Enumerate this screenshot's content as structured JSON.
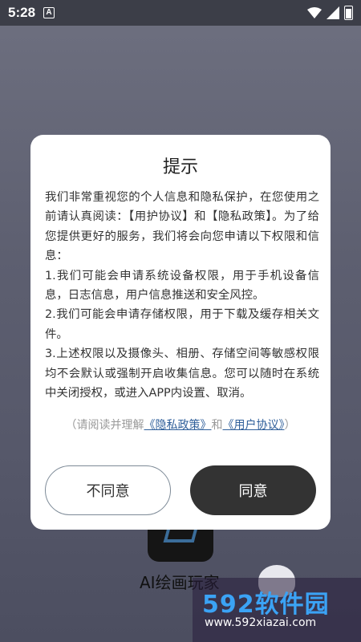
{
  "status_bar": {
    "time": "5:28",
    "notification_icon": "A"
  },
  "background_app": {
    "name": "AI绘画玩家"
  },
  "dialog": {
    "title": "提示",
    "paragraphs": [
      "我们非常重视您的个人信息和隐私保护，在您使用之前请认真阅读：【用护协议】和【隐私政策】。为了给您提供更好的服务，我们将会向您申请以下权限和信息：",
      "1.我们可能会申请系统设备权限，用于手机设备信息，日志信息，用户信息推送和安全风控。",
      "2.我们可能会申请存储权限，用于下载及缓存相关文件。",
      "3.上述权限以及摄像头、相册、存储空间等敏感权限均不会默认或强制开启收集信息。您可以随时在系统中关闭授权，或进入APP内设置、取消。"
    ],
    "hint_prefix": "（请阅读并理解",
    "privacy_link": "《隐私政策》",
    "hint_and": "和",
    "user_link": "《用户协议》",
    "hint_suffix": "）",
    "disagree_label": "不同意",
    "agree_label": "同意"
  },
  "watermark": {
    "title": "592软件园",
    "url": "www.592xiazai.com"
  }
}
